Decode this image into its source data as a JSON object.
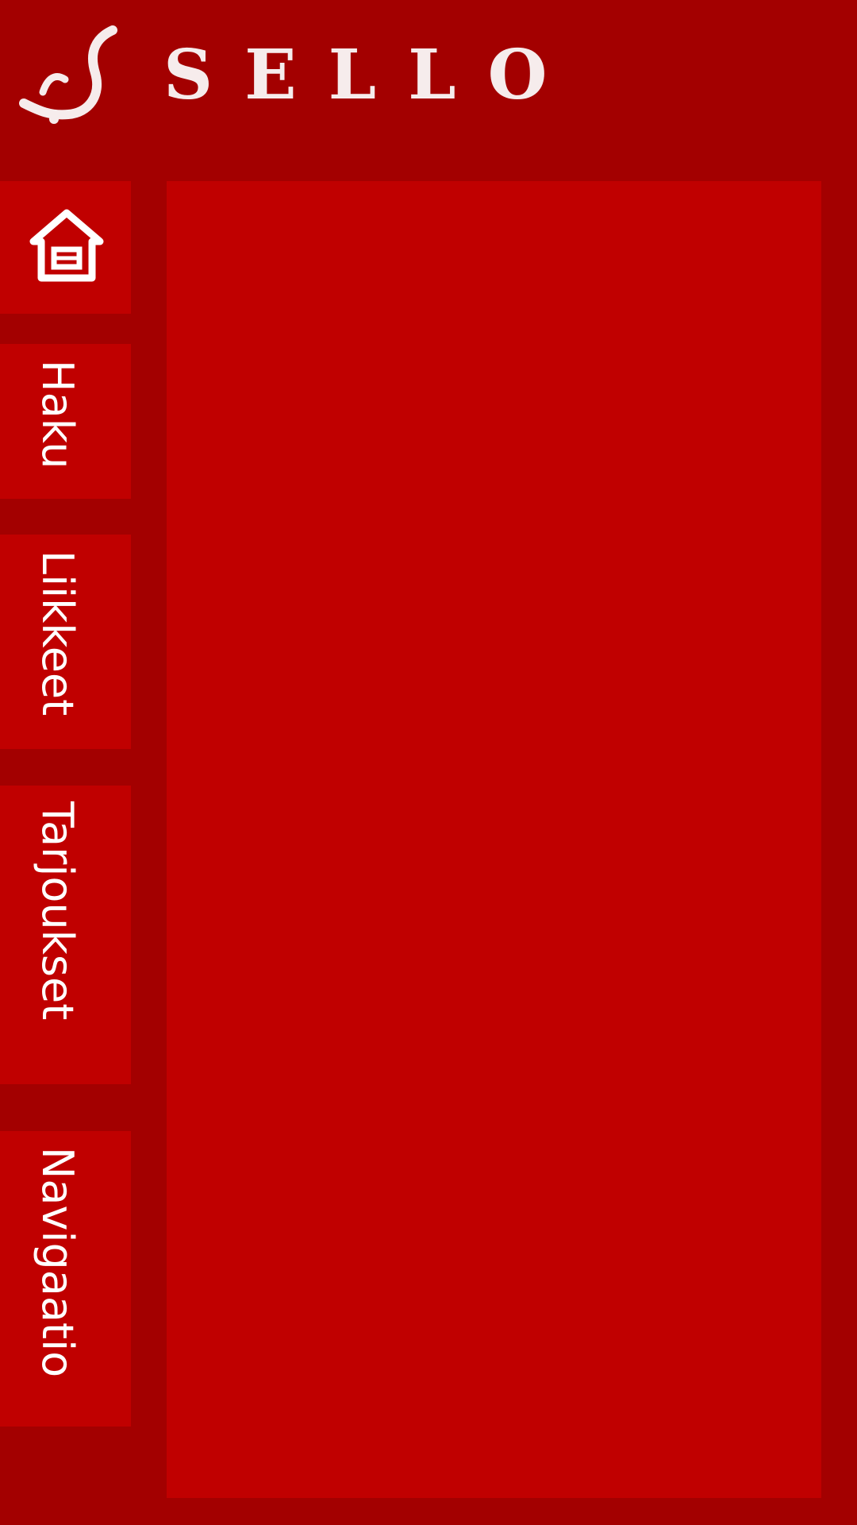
{
  "brand": {
    "name": "SELLO",
    "logo_icon": "sello-script-logo-icon"
  },
  "nav": {
    "home": {
      "icon": "home-icon"
    },
    "items": [
      {
        "label": "Haku"
      },
      {
        "label": "Liikkeet"
      },
      {
        "label": "Tarjoukset"
      },
      {
        "label": "Navigaatio"
      }
    ]
  },
  "colors": {
    "background": "#a30000",
    "panel": "#c00000",
    "text": "#ffffff"
  }
}
